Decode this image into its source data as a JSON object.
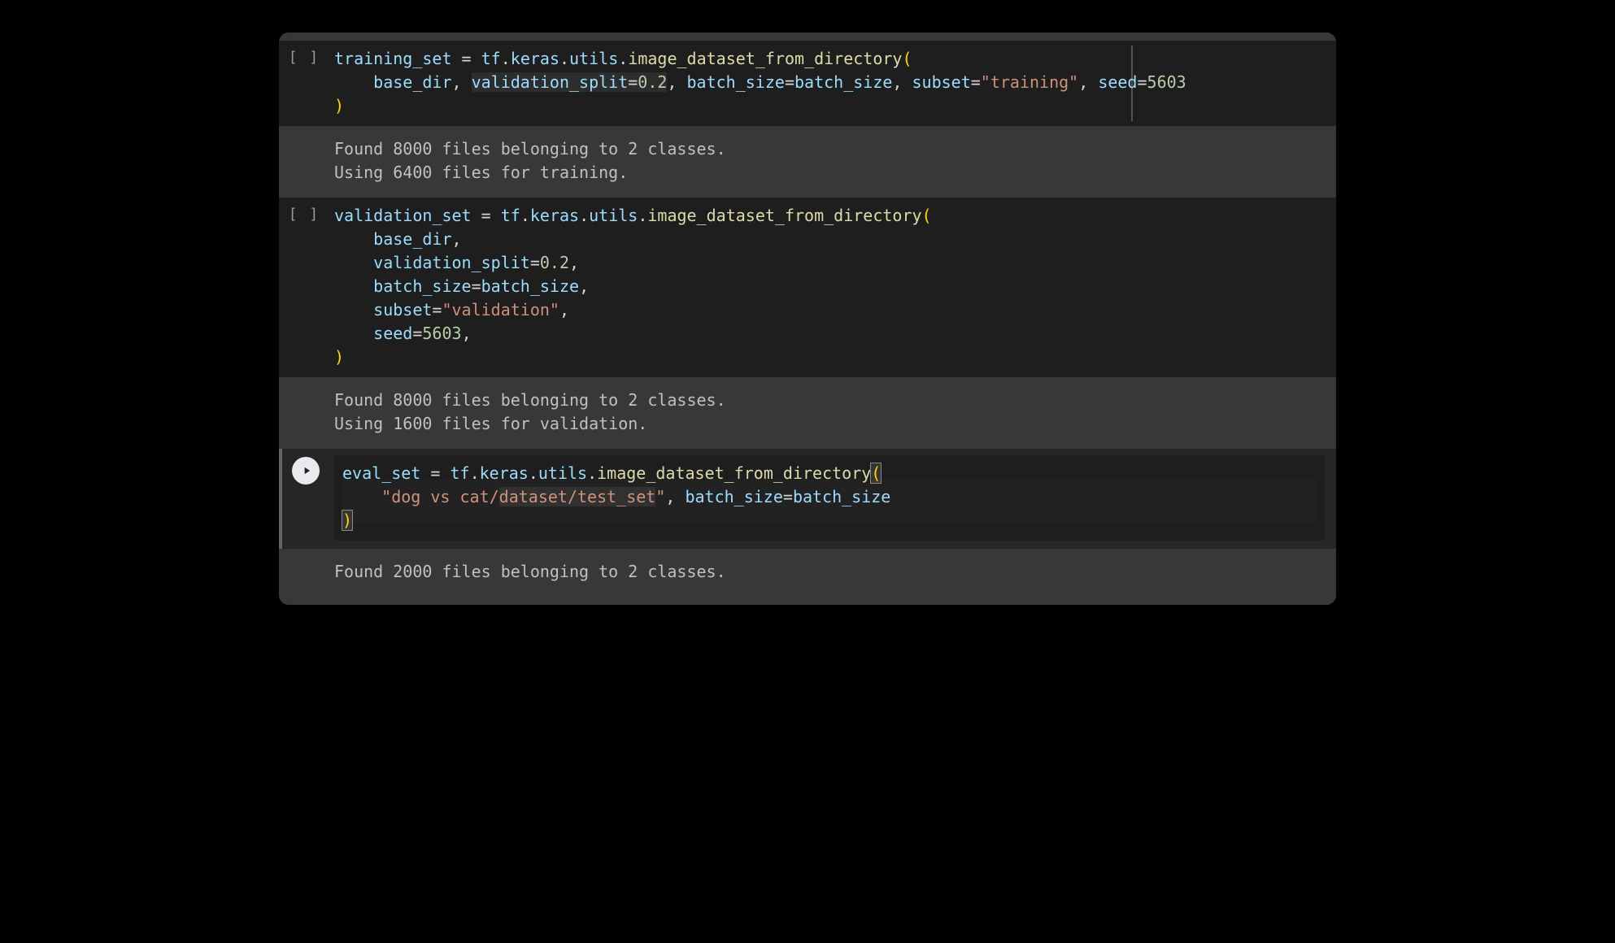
{
  "cells": [
    {
      "prompt": "[ ]",
      "code_html": "<span class='tk-var'>training_set</span> <span class='tk-punc'>=</span> <span class='tk-var'>tf</span><span class='tk-punc'>.</span><span class='tk-var'>keras</span><span class='tk-punc'>.</span><span class='tk-var'>utils</span><span class='tk-punc'>.</span><span class='tk-fn'>image_dataset_from_directory</span><span class='tk-paren-y'>(</span>\n    <span class='tk-var'>base_dir</span><span class='tk-punc'>,</span> <span class='highlight-arg'><span class='tk-param'>validation_split</span><span class='tk-punc'>=</span><span class='tk-num'>0.2</span></span><span class='tk-punc'>,</span> <span class='tk-param'>batch_size</span><span class='tk-punc'>=</span><span class='tk-var'>batch_size</span><span class='tk-punc'>,</span> <span class='tk-param'>subset</span><span class='tk-punc'>=</span><span class='tk-str'>\"training\"</span><span class='tk-punc'>,</span> <span class='tk-param'>seed</span><span class='tk-punc'>=</span><span class='tk-num'>5603</span>\n<span class='tk-paren-y'>)</span>",
      "output": "Found 8000 files belonging to 2 classes.\nUsing 6400 files for training."
    },
    {
      "prompt": "[ ]",
      "code_html": "<span class='tk-var'>validation_set</span> <span class='tk-punc'>=</span> <span class='tk-var'>tf</span><span class='tk-punc'>.</span><span class='tk-var'>keras</span><span class='tk-punc'>.</span><span class='tk-var'>utils</span><span class='tk-punc'>.</span><span class='tk-fn'>image_dataset_from_directory</span><span class='tk-paren-y'>(</span>\n    <span class='tk-var'>base_dir</span><span class='tk-punc'>,</span>\n    <span class='tk-param'>validation_split</span><span class='tk-punc'>=</span><span class='tk-num'>0.2</span><span class='tk-punc'>,</span>\n    <span class='tk-param'>batch_size</span><span class='tk-punc'>=</span><span class='tk-var'>batch_size</span><span class='tk-punc'>,</span>\n    <span class='tk-param'>subset</span><span class='tk-punc'>=</span><span class='tk-str'>\"validation\"</span><span class='tk-punc'>,</span>\n    <span class='tk-param'>seed</span><span class='tk-punc'>=</span><span class='tk-num'>5603</span><span class='tk-punc'>,</span>\n<span class='tk-paren-y'>)</span>",
      "output": "Found 8000 files belonging to 2 classes.\nUsing 1600 files for validation."
    },
    {
      "prompt": "run",
      "code_html": "<span class='tk-var'>eval_set</span> <span class='tk-punc'>=</span> <span class='tk-var'>tf</span><span class='tk-punc'>.</span><span class='tk-var'>keras</span><span class='tk-punc'>.</span><span class='tk-var'>utils</span><span class='tk-punc'>.</span><span class='tk-fn'>image_dataset_from_directory</span><span class='tk-paren-y highlight-bracket'>(</span>\n    <span class='tk-str'>\"dog vs cat/<span class='highlight-arg'>dataset/test_set</span>\"</span><span class='tk-punc'>,</span> <span class='tk-param'>batch_size</span><span class='tk-punc'>=</span><span class='tk-var'>batch_size</span>\n<span class='tk-paren-y highlight-bracket'>)</span>",
      "output": "Found 2000 files belonging to 2 classes."
    }
  ]
}
